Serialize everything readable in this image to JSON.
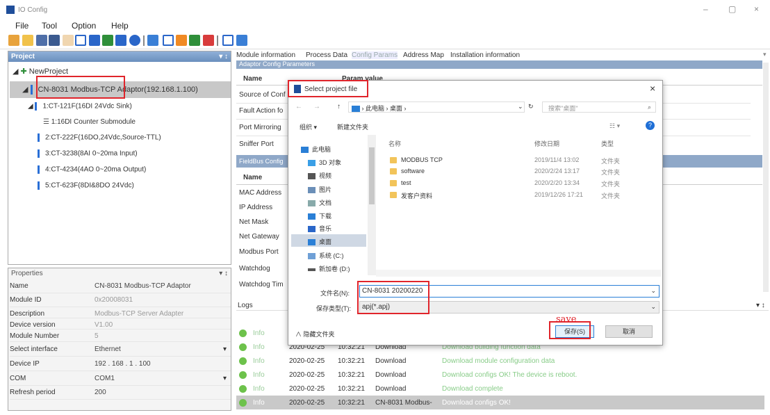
{
  "window": {
    "title": "IO Config",
    "minimize": "–",
    "maximize": "▢",
    "close": "×"
  },
  "menu": [
    "File",
    "Tool",
    "Option",
    "Help"
  ],
  "project_panel": {
    "title": "Project",
    "pin": "▾ ↕",
    "root": "NewProject",
    "adaptor": "CN-8031 Modbus-TCP Adaptor(192.168.1.100)",
    "modules": [
      {
        "label": "1:CT-121F(16DI 24Vdc Sink)"
      },
      {
        "label": "1:16DI Counter Submodule"
      },
      {
        "label": "2:CT-222F(16DO,24Vdc,Source-TTL)"
      },
      {
        "label": "3:CT-3238(8AI 0~20ma Input)"
      },
      {
        "label": "4:CT-4234(4AO 0~20ma Output)"
      },
      {
        "label": "5:CT-623F(8DI&8DO 24Vdc)"
      }
    ]
  },
  "properties": {
    "title": "Properties",
    "pin": "▾ ↕",
    "rows": [
      {
        "k": "Name",
        "v": "CN-8031 Modbus-TCP Adaptor"
      },
      {
        "k": "Module ID",
        "v": "0x20008031"
      },
      {
        "k": "Description",
        "v": "Modbus-TCP Server Adapter"
      },
      {
        "k": "Device version",
        "v": "V1.00"
      },
      {
        "k": "Module Number",
        "v": "5"
      },
      {
        "k": "Select interface",
        "v": "Ethernet"
      },
      {
        "k": "Device IP",
        "v": "192 . 168 . 1 . 100"
      },
      {
        "k": "COM",
        "v": "COM1"
      },
      {
        "k": "Refresh period",
        "v": "200"
      }
    ]
  },
  "tabs": [
    "Module information",
    "Process Data",
    "Config Params",
    "Address Map",
    "Installation information"
  ],
  "adaptor_config": {
    "section": "Adaptor Config Parameters",
    "col_name": "Name",
    "col_value": "Param value",
    "rows": [
      "Source of Conf",
      "Fault Action fo",
      "Port Mirroring",
      "Sniffer Port"
    ]
  },
  "fieldbus_config": {
    "section": "FieldBus Config",
    "col_name": "Name",
    "rows": [
      "MAC Address",
      "IP Address",
      "Net Mask",
      "Net Gateway",
      "Modbus Port",
      "Watchdog",
      "Watchdog Tim"
    ]
  },
  "logs": {
    "title": "Logs",
    "pin": "▾ ↕",
    "rows": [
      {
        "level": "Info",
        "date": "",
        "time": "",
        "source": "",
        "msg": ""
      },
      {
        "level": "Info",
        "date": "2020-02-25",
        "time": "10:32:21",
        "source": "Download",
        "msg": "Download building function data"
      },
      {
        "level": "Info",
        "date": "2020-02-25",
        "time": "10:32:21",
        "source": "Download",
        "msg": "Download module configuration data"
      },
      {
        "level": "Info",
        "date": "2020-02-25",
        "time": "10:32:21",
        "source": "Download",
        "msg": "Download configs OK! The device is reboot."
      },
      {
        "level": "Info",
        "date": "2020-02-25",
        "time": "10:32:21",
        "source": "Download",
        "msg": "Download complete"
      },
      {
        "level": "Info",
        "date": "2020-02-25",
        "time": "10:32:21",
        "source": "CN-8031 Modbus-",
        "msg": "Download configs OK!"
      }
    ]
  },
  "dialog": {
    "title": "Select project file",
    "close": "×",
    "path": [
      "此电脑",
      "桌面"
    ],
    "search_placeholder": "搜索\"桌面\"",
    "organize": "组织 ▾",
    "new_folder": "新建文件夹",
    "nav": [
      "此电脑",
      "3D 对象",
      "视频",
      "图片",
      "文档",
      "下载",
      "音乐",
      "桌面",
      "系统 (C:)",
      "新加卷 (D:)"
    ],
    "col_name": "名称",
    "col_date": "修改日期",
    "col_type": "类型",
    "files": [
      {
        "name": "MODBUS TCP",
        "date": "2019/11/4 13:02",
        "type": "文件夹"
      },
      {
        "name": "software",
        "date": "2020/2/24 13:17",
        "type": "文件夹"
      },
      {
        "name": "test",
        "date": "2020/2/20 13:34",
        "type": "文件夹"
      },
      {
        "name": "发客户资料",
        "date": "2019/12/26 17:21",
        "type": "文件夹"
      }
    ],
    "filename_label": "文件名(N):",
    "filename_value": "CN-8031 20200220",
    "filetype_label": "保存类型(T):",
    "filetype_value": "apj(*.apj)",
    "hide_folders": "隐藏文件夹",
    "save": "保存(S)",
    "cancel": "取消",
    "annotation": "save"
  }
}
